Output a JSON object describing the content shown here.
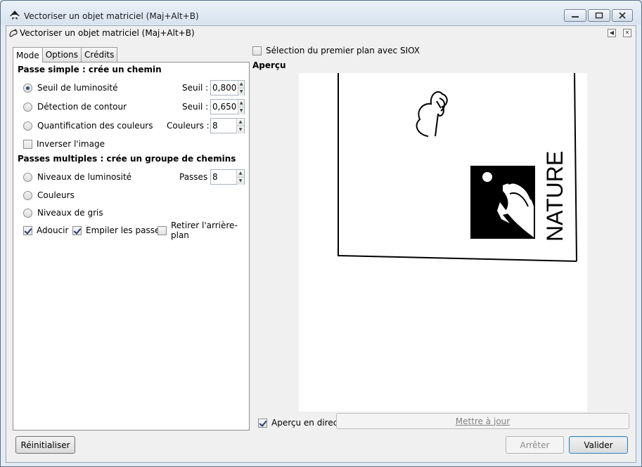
{
  "window": {
    "title": "Vectoriser un objet matriciel (Maj+Alt+B)",
    "buttons": [
      "minimize",
      "maximize",
      "close"
    ]
  },
  "dock": {
    "title": "Vectoriser un objet matriciel (Maj+Alt+B)"
  },
  "tabs": [
    {
      "label": "Mode",
      "active": true
    },
    {
      "label": "Options",
      "active": false
    },
    {
      "label": "Crédits",
      "active": false
    }
  ],
  "single_pass": {
    "title": "Passe simple : crée un chemin",
    "options": [
      {
        "label": "Seuil de luminosité",
        "selected": true,
        "field_label": "Seuil :",
        "value": "0,800"
      },
      {
        "label": "Détection de contour",
        "selected": false,
        "field_label": "Seuil :",
        "value": "0,650"
      },
      {
        "label": "Quantification des couleurs",
        "selected": false,
        "field_label": "Couleurs :",
        "value": "8"
      }
    ],
    "invert_label": "Inverser l'image",
    "invert_checked": false
  },
  "multi_pass": {
    "title": "Passes multiples : crée un groupe de chemins",
    "options": [
      {
        "label": "Niveaux de luminosité",
        "selected": false,
        "field_label": "Passes :",
        "value": "8"
      },
      {
        "label": "Couleurs",
        "selected": false
      },
      {
        "label": "Niveaux de gris",
        "selected": false
      }
    ],
    "smooth_label": "Adoucir",
    "smooth_checked": true,
    "stack_label": "Empiler les passes",
    "stack_checked": true,
    "remove_bg_label": "Retirer l'arrière-plan",
    "remove_bg_checked": false
  },
  "siox": {
    "label": "Sélection du premier plan avec SIOX",
    "checked": false
  },
  "preview": {
    "label": "Aperçu",
    "image_text": "NATURE",
    "live_label": "Aperçu en direct",
    "live_checked": true,
    "update_label": "Mettre à jour"
  },
  "footer": {
    "reset_label": "Réinitialiser",
    "stop_label": "Arrêter",
    "ok_label": "Valider"
  }
}
